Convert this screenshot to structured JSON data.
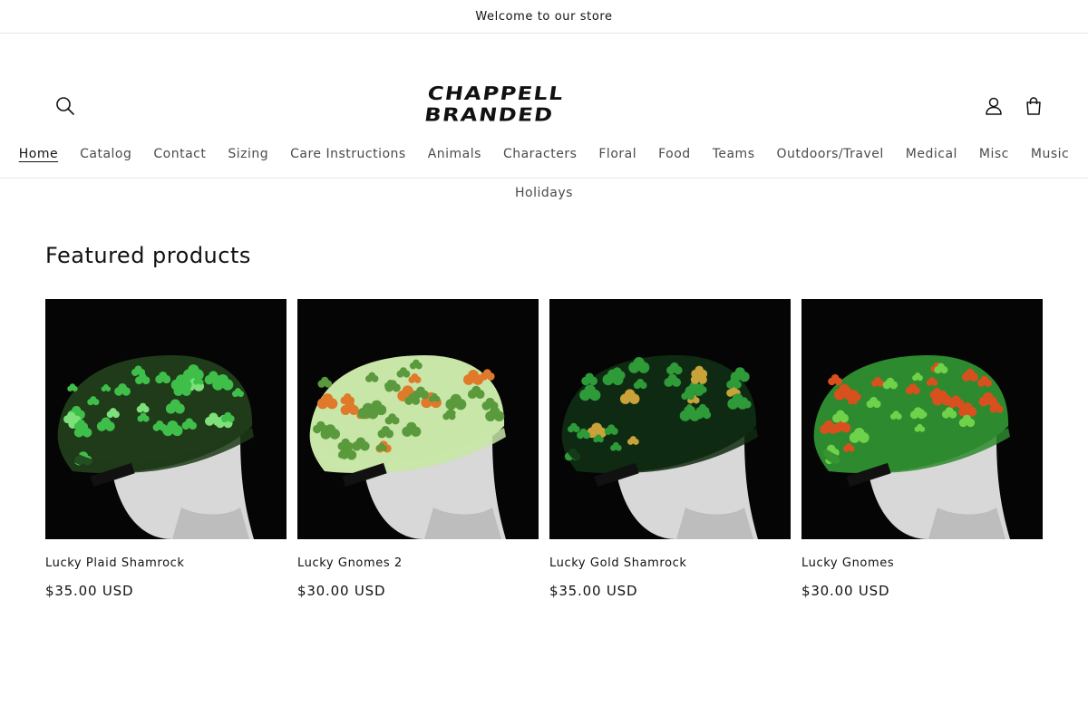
{
  "announcement": {
    "text": "Welcome to our store"
  },
  "header": {
    "logo_text": "Chappell Branded",
    "icons": {
      "search": "search-icon",
      "account": "account-icon",
      "cart": "cart-icon"
    }
  },
  "nav": {
    "items": [
      {
        "label": "Home",
        "active": true
      },
      {
        "label": "Catalog"
      },
      {
        "label": "Contact"
      },
      {
        "label": "Sizing"
      },
      {
        "label": "Care Instructions"
      },
      {
        "label": "Animals"
      },
      {
        "label": "Characters"
      },
      {
        "label": "Floral"
      },
      {
        "label": "Food"
      },
      {
        "label": "Teams"
      },
      {
        "label": "Outdoors/Travel"
      },
      {
        "label": "Medical"
      },
      {
        "label": "Misc"
      },
      {
        "label": "Music"
      },
      {
        "label": "Holidays"
      }
    ]
  },
  "featured": {
    "title": "Featured products",
    "products": [
      {
        "title": "Lucky Plaid Shamrock",
        "price": "$35.00 USD",
        "hat_color": "#1f3b1a",
        "pattern_color": "#3fbf4a",
        "accent_color": "#7ee07a"
      },
      {
        "title": "Lucky Gnomes 2",
        "price": "$30.00 USD",
        "hat_color": "#c8e6a8",
        "pattern_color": "#5a9a3c",
        "accent_color": "#e07a2a"
      },
      {
        "title": "Lucky Gold Shamrock",
        "price": "$35.00 USD",
        "hat_color": "#0f2a12",
        "pattern_color": "#2e9a38",
        "accent_color": "#c9a23a"
      },
      {
        "title": "Lucky Gnomes",
        "price": "$30.00 USD",
        "hat_color": "#2e8a2e",
        "pattern_color": "#d8501e",
        "accent_color": "#6fd24a"
      }
    ]
  }
}
